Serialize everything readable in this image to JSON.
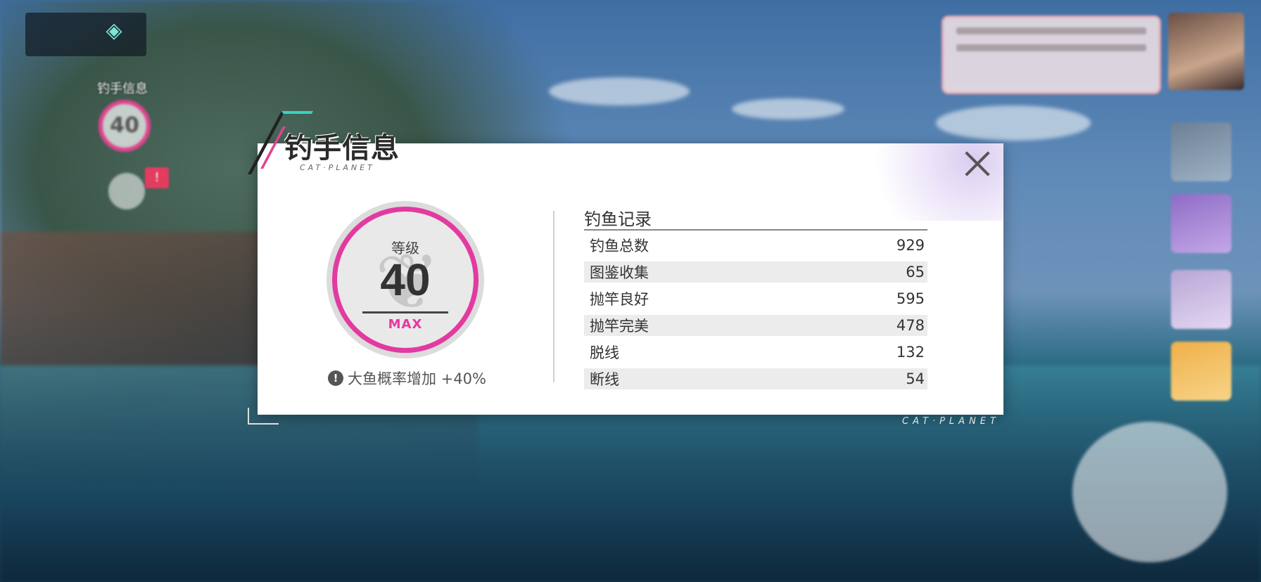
{
  "modal": {
    "title": "钓手信息",
    "subtitle": "CAT·PLANET"
  },
  "level": {
    "label": "等级",
    "value": "40",
    "max_label": "MAX",
    "accent_color": "#e23aa0"
  },
  "bonus": {
    "icon": "!",
    "text": "大鱼概率增加 +40%"
  },
  "record": {
    "title": "钓鱼记录",
    "rows": [
      {
        "label": "钓鱼总数",
        "value": "929"
      },
      {
        "label": "图鉴收集",
        "value": "65"
      },
      {
        "label": "抛竿良好",
        "value": "595"
      },
      {
        "label": "抛竿完美",
        "value": "478"
      },
      {
        "label": "脱线",
        "value": "132"
      },
      {
        "label": "断线",
        "value": "54"
      }
    ]
  },
  "hud": {
    "level_value": "40",
    "badge": "!",
    "watermark": "CAT·PLANET"
  }
}
